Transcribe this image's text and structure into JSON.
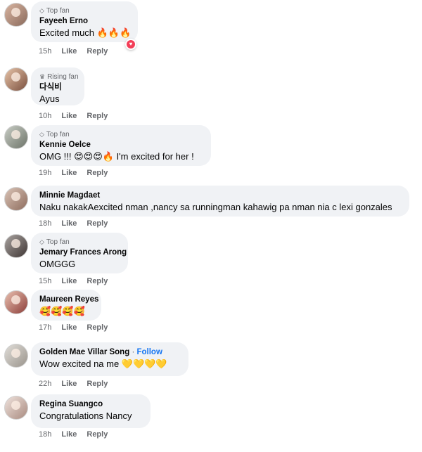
{
  "comments": [
    {
      "badge": "Top fan",
      "name": "Fayeeh Erno",
      "text": "Excited much 🔥🔥🔥",
      "time": "15h",
      "like": "Like",
      "reply": "Reply"
    },
    {
      "badge": "Rising fan",
      "name": "다식비",
      "text": "Ayus",
      "time": "10h",
      "like": "Like",
      "reply": "Reply"
    },
    {
      "badge": "Top fan",
      "name": "Kennie Oelce",
      "text": "OMG !!! 😍😍😍🔥 I'm excited for her !",
      "time": "19h",
      "like": "Like",
      "reply": "Reply"
    },
    {
      "name": "Minnie Magdaet",
      "text": "Naku nakakAexcited nman ,nancy sa runningman kahawig pa nman nia c lexi gonzales",
      "time": "18h",
      "like": "Like",
      "reply": "Reply"
    },
    {
      "badge": "Top fan",
      "name": "Jemary Frances Arong",
      "text": "OMGGG",
      "time": "15h",
      "like": "Like",
      "reply": "Reply"
    },
    {
      "name": "Maureen Reyes",
      "text": "🥰🥰🥰🥰",
      "time": "17h",
      "like": "Like",
      "reply": "Reply"
    },
    {
      "name": "Golden Mae Villar Song",
      "follow": "Follow",
      "dot": "·",
      "text": "Wow excited na me 💛💛💛💛",
      "time": "22h",
      "like": "Like",
      "reply": "Reply"
    },
    {
      "name": "Regina Suangco",
      "text": "Congratulations Nancy",
      "time": "18h",
      "like": "Like",
      "reply": "Reply"
    }
  ],
  "icons": {
    "badge": "diamond-icon",
    "reaction": "heart-icon"
  },
  "colors": {
    "bubble": "#f0f2f5",
    "meta": "#65676b",
    "follow": "#1877f2",
    "love": "#f33e58"
  }
}
